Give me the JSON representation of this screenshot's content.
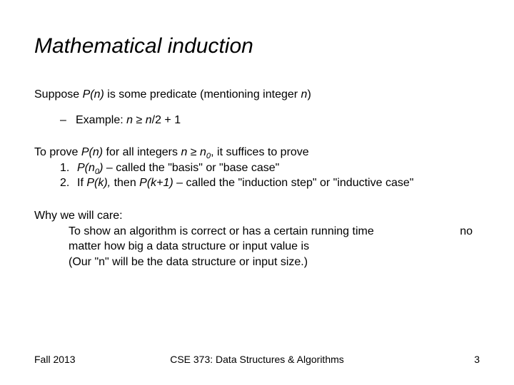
{
  "title": "Mathematical induction",
  "line_suppose_pre": "Suppose ",
  "line_suppose_pn": "P(n)",
  "line_suppose_mid": " is some predicate (mentioning integer ",
  "line_suppose_n": "n",
  "line_suppose_post": ")",
  "example_pre": "Example: ",
  "example_n": "n",
  "example_mid": " ≥ ",
  "example_n2": "n",
  "example_post": "/2 + 1",
  "prove_pre": "To prove ",
  "prove_pn": "P(n)",
  "prove_mid1": " for all integers ",
  "prove_n": "n",
  "prove_geq": " ≥ ",
  "prove_n0_n": "n",
  "prove_n0_sub": "0",
  "prove_post": ", it suffices to prove",
  "step1_num": "1.",
  "step1_pn0_p": "P(n",
  "step1_pn0_sub": "0",
  "step1_pn0_close": ")",
  "step1_post": " – called the \"basis\" or \"base case\"",
  "step2_num": "2.",
  "step2_pre": "If ",
  "step2_pk": "P(k),",
  "step2_mid": " then ",
  "step2_pk1": "P(k+1)",
  "step2_post": " – called the \"induction step\" or \"inductive case\"",
  "why_heading": "Why we will care:",
  "why_line1_main": "To show an algorithm is correct or has a certain running time",
  "why_line1_no": "no",
  "why_line2": "matter how big a data structure or input value is",
  "why_line3": "(Our \"n\" will be the data structure or input size.)",
  "footer_left": "Fall 2013",
  "footer_center": "CSE 373: Data Structures & Algorithms",
  "footer_right": "3"
}
